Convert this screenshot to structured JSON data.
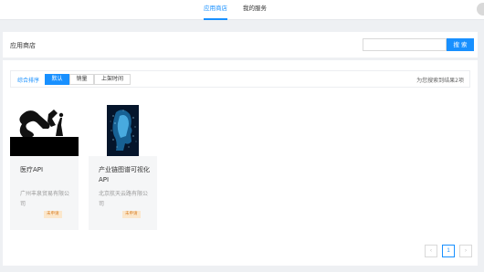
{
  "nav": {
    "tabs": [
      {
        "label": "应用商店",
        "active": true
      },
      {
        "label": "我的服务",
        "active": false
      }
    ]
  },
  "header": {
    "title": "应用商店",
    "search_placeholder": "",
    "search_button": "搜 索"
  },
  "sortbar": {
    "label": "综合排序",
    "options": [
      {
        "label": "默认",
        "active": true
      },
      {
        "label": "销量",
        "active": false
      },
      {
        "label": "上架时间",
        "active": false
      }
    ],
    "result_text": "为您搜索到结果2项"
  },
  "cards": [
    {
      "name": "医疗API",
      "company": "广州丰泉贸易有限公司",
      "badge": "未申请",
      "image": "logo-image"
    },
    {
      "name": "产业链图谱可视化API",
      "company": "北京航天云路有限公司",
      "badge": "未申请",
      "image": "digital-face-image"
    }
  ],
  "pagination": {
    "prev": "‹",
    "current": "1",
    "next": "›"
  },
  "colors": {
    "accent": "#1890ff",
    "badge_bg": "#fbe7cc",
    "badge_text": "#d9822b",
    "page_bg": "#eef0f3"
  }
}
